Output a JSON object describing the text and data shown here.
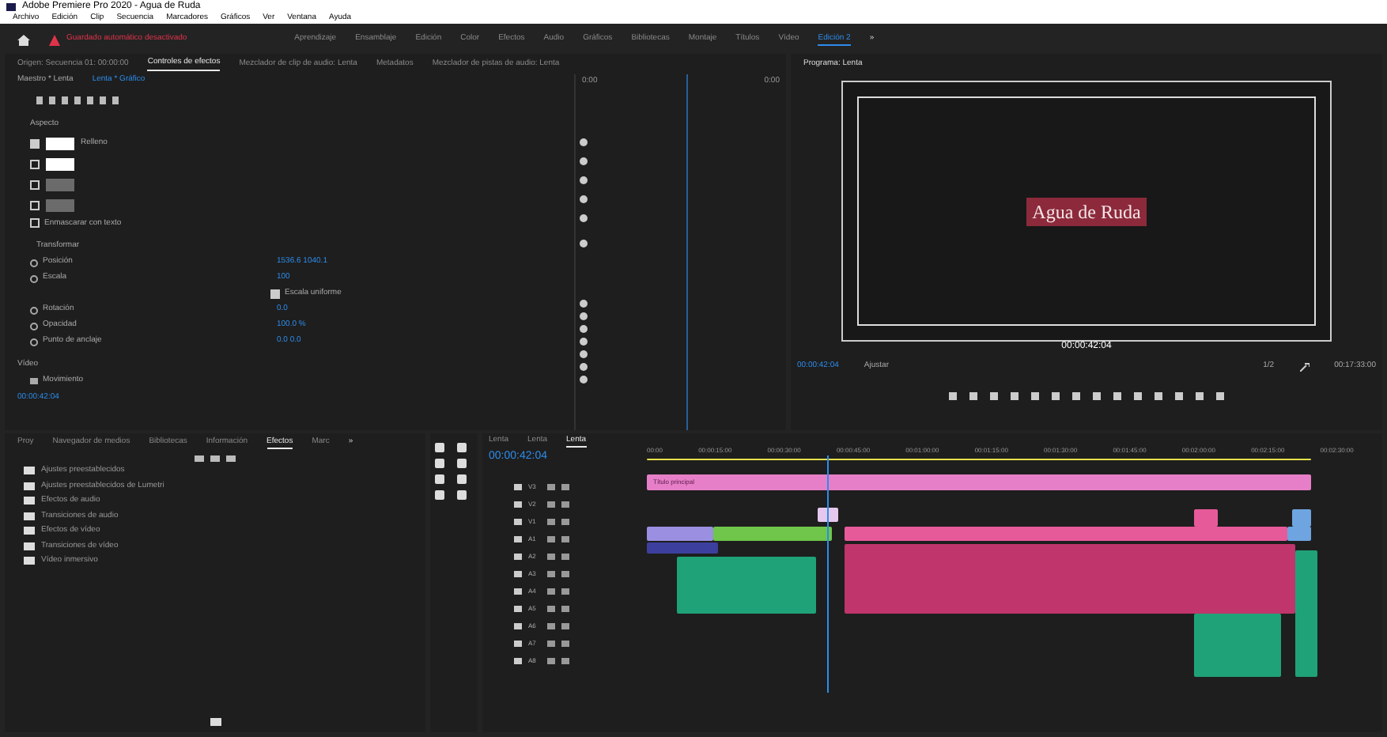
{
  "window": {
    "title": "Adobe Premiere Pro 2020 - Agua de Ruda"
  },
  "menu": [
    "Archivo",
    "Edición",
    "Clip",
    "Secuencia",
    "Marcadores",
    "Gráficos",
    "Ver",
    "Ventana",
    "Ayuda"
  ],
  "header": {
    "warning": "Guardado automático desactivado",
    "workspaces": [
      {
        "label": "Aprendizaje",
        "selected": false
      },
      {
        "label": "Ensamblaje",
        "selected": false
      },
      {
        "label": "Edición",
        "selected": false
      },
      {
        "label": "Color",
        "selected": false
      },
      {
        "label": "Efectos",
        "selected": false
      },
      {
        "label": "Audio",
        "selected": false
      },
      {
        "label": "Gráficos",
        "selected": false
      },
      {
        "label": "Bibliotecas",
        "selected": false
      },
      {
        "label": "Montaje",
        "selected": false
      },
      {
        "label": "Títulos",
        "selected": false
      },
      {
        "label": "Vídeo",
        "selected": false
      },
      {
        "label": "Edición 2",
        "selected": true
      }
    ],
    "more": "»"
  },
  "effect_panel": {
    "tabs": [
      {
        "label": "Origen: Secuencia 01: 00:00:00",
        "selected": false
      },
      {
        "label": "Controles de efectos",
        "selected": true
      },
      {
        "label": "Mezclador de clip de audio: Lenta",
        "selected": false
      },
      {
        "label": "Metadatos",
        "selected": false
      },
      {
        "label": "Mezclador de pistas de audio: Lenta",
        "selected": false
      }
    ],
    "source": "Maestro * Lenta",
    "clip": "Lenta * Gráfico",
    "mini_start": "0:00",
    "mini_end": "0:00",
    "appearance_title": "Aspecto",
    "appearance": [
      {
        "checked": true,
        "color": "#ffffff",
        "label": "Relleno"
      },
      {
        "checked": false,
        "color": "#ffffff"
      },
      {
        "checked": false,
        "color": "#6b6b6b"
      },
      {
        "checked": false,
        "color": "#6b6b6b"
      }
    ],
    "mask": {
      "label": "Enmascarar con texto",
      "checked": false
    },
    "transform_title": "Transformar",
    "properties": [
      {
        "label": "Posición",
        "value": "1536.6   1040.1"
      },
      {
        "label": "Escala",
        "value": "100"
      },
      {
        "label": "Escala uniforme",
        "kind": "checkbox",
        "checked": true
      },
      {
        "label": "Rotación",
        "value": "0.0"
      },
      {
        "label": "Opacidad",
        "value": "100.0 %"
      },
      {
        "label": "Punto de anclaje",
        "value": "0.0   0.0"
      }
    ],
    "video_title": "Vídeo",
    "motion": "Movimiento",
    "timecode": "00:00:42:04"
  },
  "program": {
    "tab": "Programa: Lenta",
    "title": "Agua de Ruda",
    "timecode": "00:00:42:04",
    "playhead": "00:00:42:04",
    "fit": "Ajustar",
    "quality": "1/2",
    "duration": "00:17:33:00"
  },
  "effects_panel": {
    "tabs": [
      {
        "label": "Proy",
        "selected": false
      },
      {
        "label": "Navegador de medios",
        "selected": false
      },
      {
        "label": "Bibliotecas",
        "selected": false
      },
      {
        "label": "Información",
        "selected": false
      },
      {
        "label": "Efectos",
        "selected": true
      },
      {
        "label": "Marc",
        "selected": false
      }
    ],
    "more": "»",
    "folders": [
      "Ajustes preestablecidos",
      "Ajustes preestablecidos de Lumetri",
      "Efectos de audio",
      "Transiciones de audio",
      "Efectos de vídeo",
      "Transiciones de vídeo",
      "Vídeo inmersivo"
    ]
  },
  "timeline": {
    "tabs": [
      {
        "label": "Lenta",
        "selected": false
      },
      {
        "label": "Lenta",
        "selected": false
      },
      {
        "label": "Lenta",
        "selected": true
      }
    ],
    "timecode": "00:00:42:04",
    "ruler": [
      "00:00",
      "00:00:15:00",
      "00:00:30:00",
      "00:00:45:00",
      "00:01:00:00",
      "00:01:15:00",
      "00:01:30:00",
      "00:01:45:00",
      "00:02:00:00",
      "00:02:15:00",
      "00:02:30:00"
    ],
    "tracks": [
      "V3",
      "V2",
      "V1",
      "A1",
      "A2",
      "A3",
      "A4",
      "A5",
      "A6",
      "A7",
      "A8"
    ],
    "title_clip": "Título principal"
  }
}
